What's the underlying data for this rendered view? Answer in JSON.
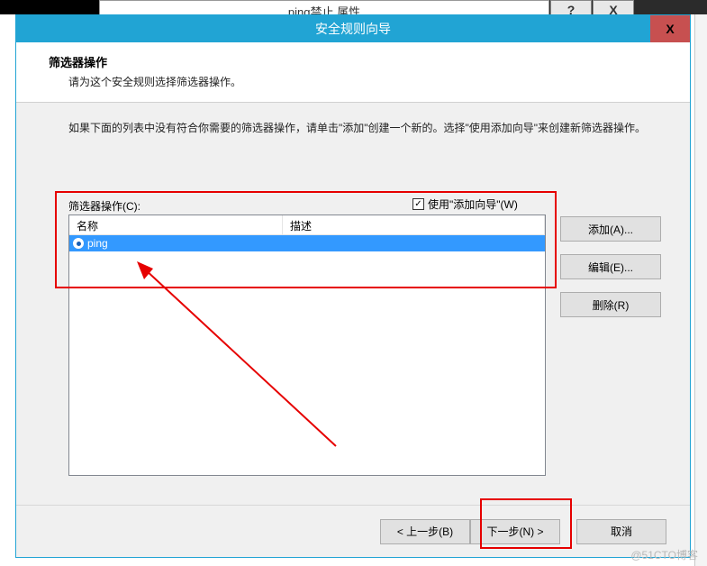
{
  "behind_window": {
    "title": "ping禁止 属性",
    "help": "?",
    "close": "X"
  },
  "wizard": {
    "title": "安全规则向导",
    "close_glyph": "X",
    "header_title": "筛选器操作",
    "header_subtitle": "请为这个安全规则选择筛选器操作。",
    "instruction": "如果下面的列表中没有符合你需要的筛选器操作，请单击\"添加\"创建一个新的。选择\"使用添加向导\"来创建新筛选器操作。",
    "filters_group_label": "筛选器操作(C):",
    "use_add_wizard": {
      "label": "使用\"添加向导\"(W)",
      "checked": "✓"
    },
    "list": {
      "columns": {
        "name": "名称",
        "desc": "描述"
      },
      "rows": [
        {
          "name": "ping",
          "desc": ""
        }
      ]
    },
    "side_buttons": {
      "add": "添加(A)...",
      "edit": "编辑(E)...",
      "remove": "删除(R)"
    },
    "nav": {
      "back": "< 上一步(B)",
      "next": "下一步(N) >",
      "cancel": "取消"
    }
  },
  "watermark": "@51CTO博客"
}
